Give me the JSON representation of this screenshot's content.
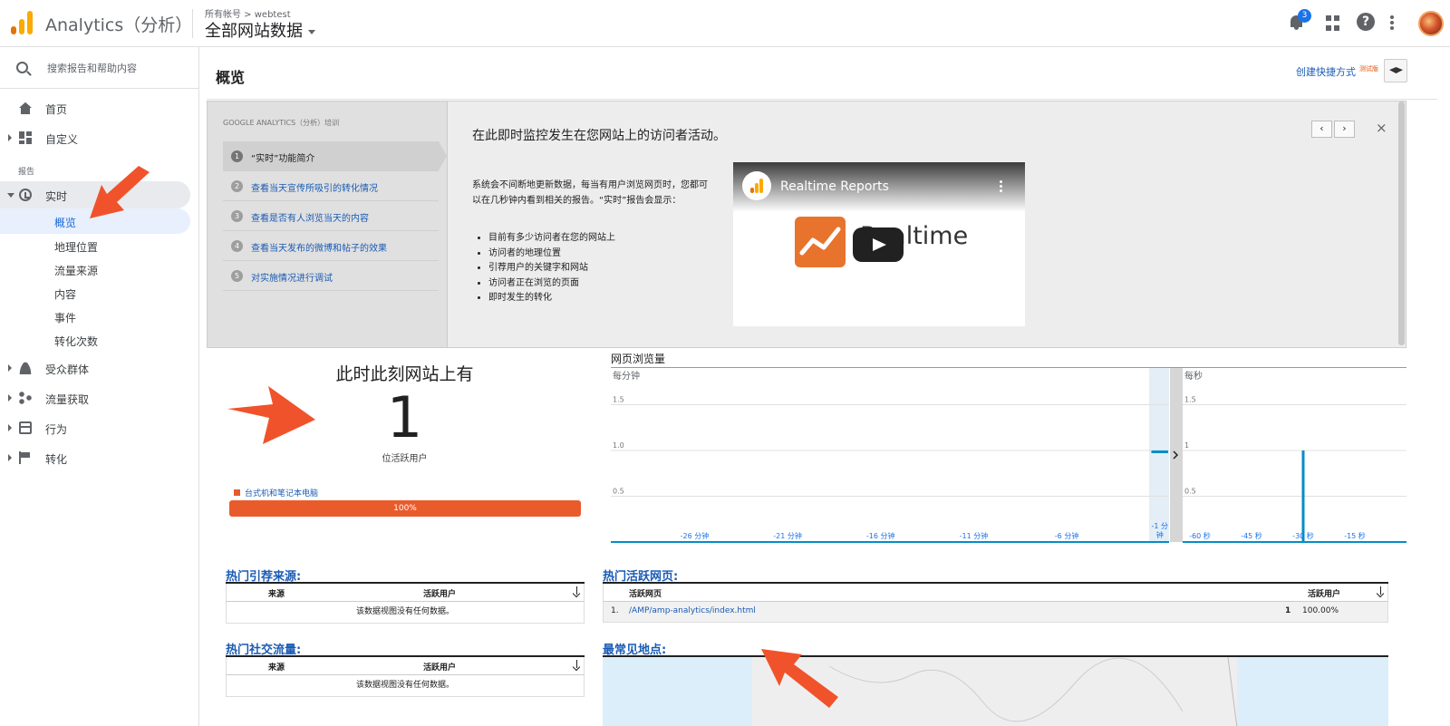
{
  "app": {
    "title": "Analytics（分析）",
    "logo_colors": [
      "#f9ab00",
      "#e37400"
    ]
  },
  "header": {
    "breadcrumb": "所有帐号 > webtest",
    "view_name": "全部网站数据",
    "notification_count": "3"
  },
  "sidebar": {
    "search_placeholder": "搜索报告和帮助内容",
    "home": "首页",
    "customize": "自定义",
    "reports_label": "报告",
    "realtime": "实时",
    "realtime_items": [
      "概览",
      "地理位置",
      "流量来源",
      "内容",
      "事件",
      "转化次数"
    ],
    "audience": "受众群体",
    "acquisition": "流量获取",
    "behavior": "行为",
    "conversions": "转化"
  },
  "page": {
    "title": "概览",
    "shortcut": "创建快捷方式",
    "beta": "测试版"
  },
  "training": {
    "heading": "GOOGLE ANALYTICS（分析）培训",
    "steps": [
      {
        "num": "1",
        "label": "“实时”功能简介"
      },
      {
        "num": "2",
        "label": "查看当天宣传所吸引的转化情况"
      },
      {
        "num": "3",
        "label": "查看是否有人浏览当天的内容"
      },
      {
        "num": "4",
        "label": "查看当天发布的微博和帖子的效果"
      },
      {
        "num": "5",
        "label": "对实施情况进行调试"
      }
    ],
    "title": "在此即时监控发生在您网站上的访问者活动。",
    "description": "系统会不间断地更新数据，每当有用户浏览网页时，您都可以在几秒钟内看到相关的报告。“实时”报告会显示：",
    "bullets": [
      "目前有多少访问者在您的网站上",
      "访问者的地理位置",
      "引荐用户的关键字和网站",
      "访问者正在浏览的页面",
      "即时发生的转化"
    ],
    "prev": "‹",
    "next": "›",
    "close": "×",
    "video": {
      "title": "Realtime Reports",
      "word": "Realtime"
    }
  },
  "active_users": {
    "heading": "此时此刻网站上有",
    "count": "1",
    "subtitle": "位活跃用户",
    "device_legend": "台式机和笔记本电脑",
    "device_percent": "100%",
    "device_fraction": 1.0,
    "device_color": "#ea5b2b"
  },
  "chart_data": [
    {
      "type": "bar",
      "title": "网页浏览量",
      "ylabel": "每分钟",
      "yticks": [
        "0.5",
        "1.0",
        "1.5"
      ],
      "ylim": [
        0,
        2
      ],
      "xticks": [
        "-26 分钟",
        "-21 分钟",
        "-16 分钟",
        "-11 分钟",
        "-6 分钟",
        "-1 分钟"
      ],
      "x": [
        -30,
        -29,
        -28,
        -27,
        -26,
        -25,
        -24,
        -23,
        -22,
        -21,
        -20,
        -19,
        -18,
        -17,
        -16,
        -15,
        -14,
        -13,
        -12,
        -11,
        -10,
        -9,
        -8,
        -7,
        -6,
        -5,
        -4,
        -3,
        -2,
        -1
      ],
      "values": [
        0,
        0,
        0,
        0,
        0,
        0,
        0,
        0,
        0,
        0,
        0,
        0,
        0,
        0,
        0,
        0,
        0,
        0,
        0,
        0,
        0,
        0,
        0,
        0,
        0,
        0,
        0,
        0,
        0,
        1
      ],
      "color": "#058dc7"
    },
    {
      "type": "bar",
      "ylabel": "每秒",
      "yticks": [
        "0.5",
        "1",
        "1.5"
      ],
      "ylim": [
        0,
        2
      ],
      "xticks": [
        "-60 秒",
        "-45 秒",
        "-30 秒",
        "-15 秒"
      ],
      "x": [
        -30
      ],
      "values": [
        1
      ],
      "color": "#058dc7"
    }
  ],
  "top_referrals": {
    "title": "热门引荐来源:",
    "col_source": "来源",
    "col_users": "活跃用户",
    "empty": "该数据视图没有任何数据。"
  },
  "top_social": {
    "title": "热门社交流量:",
    "col_source": "来源",
    "col_users": "活跃用户",
    "empty": "该数据视图没有任何数据。"
  },
  "top_pages": {
    "title": "热门活跃网页:",
    "col_page": "活跃网页",
    "col_users": "活跃用户",
    "rows": [
      {
        "rank": "1.",
        "page": "/AMP/amp-analytics/index.html",
        "users": "1",
        "percent": "100.00%"
      }
    ]
  },
  "top_locations": {
    "title": "最常见地点:"
  }
}
